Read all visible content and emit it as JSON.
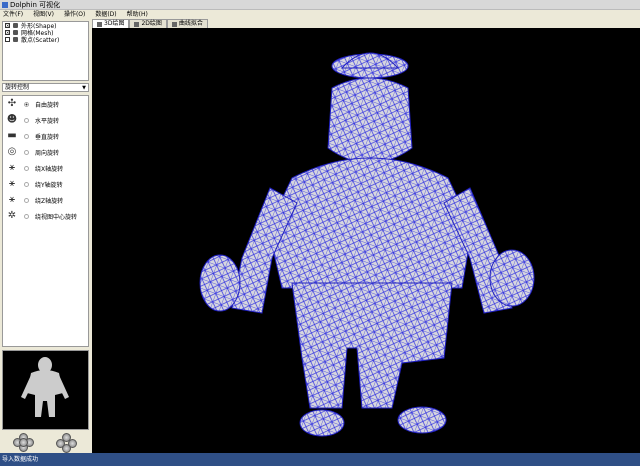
{
  "window": {
    "title": "Dolphin 可视化"
  },
  "menu": [
    {
      "label": "文件(F)"
    },
    {
      "label": "视图(V)"
    },
    {
      "label": "操作(O)"
    },
    {
      "label": "数据(D)"
    },
    {
      "label": "帮助(H)"
    }
  ],
  "layers": [
    {
      "label": "外形(Shape)",
      "checked": true
    },
    {
      "label": "网格(Mesh)",
      "checked": true
    },
    {
      "label": "散点(Scatter)",
      "checked": false
    }
  ],
  "control_select": {
    "value": "旋转控制"
  },
  "rotation_modes": [
    {
      "label": "自由旋转",
      "selected": true,
      "icon": "free-rotate-icon"
    },
    {
      "label": "水平旋转",
      "selected": false,
      "icon": "horizontal-rotate-icon"
    },
    {
      "label": "垂直旋转",
      "selected": false,
      "icon": "vertical-rotate-icon"
    },
    {
      "label": "周向旋转",
      "selected": false,
      "icon": "circular-rotate-icon"
    },
    {
      "label": "绕X轴旋转",
      "selected": false,
      "icon": "x-axis-icon"
    },
    {
      "label": "绕Y轴旋转",
      "selected": false,
      "icon": "y-axis-icon"
    },
    {
      "label": "绕Z轴旋转",
      "selected": false,
      "icon": "z-axis-icon"
    },
    {
      "label": "绕视图中心旋转",
      "selected": false,
      "icon": "view-center-icon"
    }
  ],
  "tabs": [
    {
      "label": "3D绘图",
      "active": true
    },
    {
      "label": "2D绘图",
      "active": false
    },
    {
      "label": "曲线拟合",
      "active": false
    }
  ],
  "colors": {
    "mesh": "#3030e0",
    "surface": "#d8d8e0",
    "viewport": "#000000"
  },
  "status": {
    "text": "导入数据成功"
  }
}
